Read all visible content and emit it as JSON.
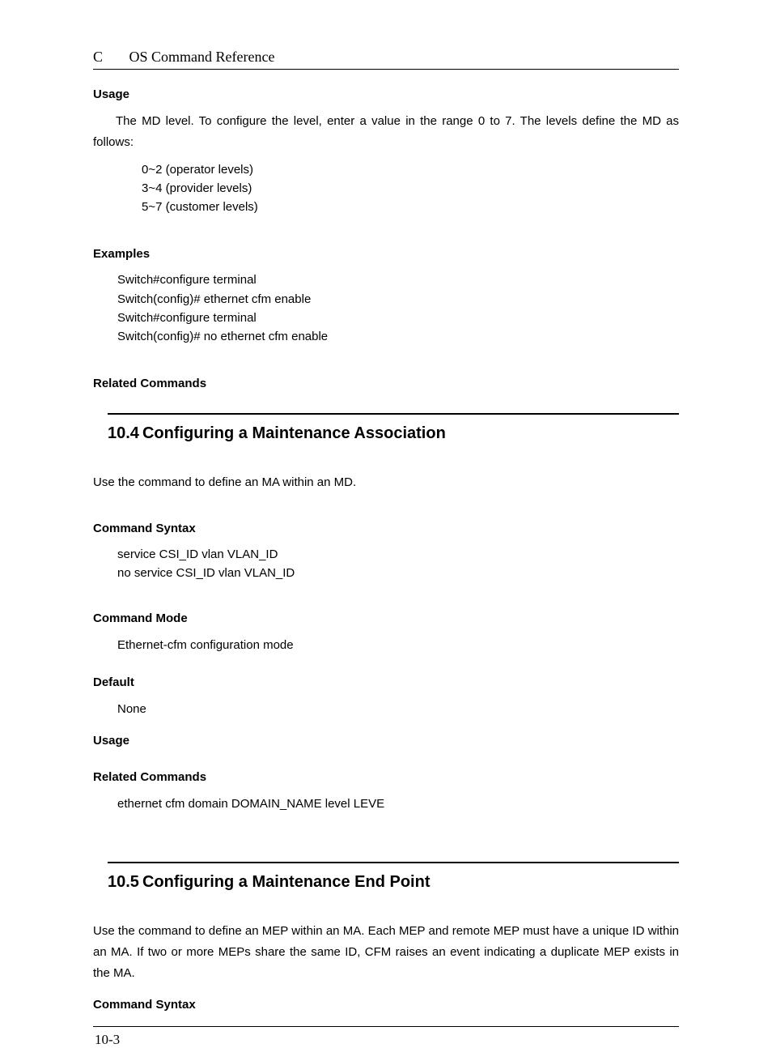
{
  "header": {
    "left": "C",
    "title": "OS Command Reference"
  },
  "sec_prev": {
    "usage_label": "Usage",
    "usage_text": "The MD level. To configure the level, enter a value in the range 0 to 7. The levels define the MD as follows:",
    "level_list": [
      "0~2 (operator levels)",
      "3~4 (provider levels)",
      "5~7 (customer levels)"
    ],
    "examples_label": "Examples",
    "examples": [
      "Switch#configure terminal",
      "Switch(config)# ethernet cfm enable",
      "Switch#configure terminal",
      "Switch(config)# no ethernet cfm enable"
    ],
    "related_label": "Related Commands"
  },
  "sec104": {
    "num": "10.4",
    "title": "Configuring a Maintenance Association",
    "intro": "Use the command to define an MA within an MD.",
    "syntax_label": "Command Syntax",
    "syntax": [
      "service CSI_ID vlan VLAN_ID",
      "no service CSI_ID vlan VLAN_ID"
    ],
    "mode_label": "Command Mode",
    "mode": "Ethernet-cfm configuration mode",
    "default_label": "Default",
    "default": "None",
    "usage_label": "Usage",
    "related_label": "Related Commands",
    "related": "ethernet cfm domain DOMAIN_NAME level LEVE"
  },
  "sec105": {
    "num": "10.5",
    "title": "Configuring a Maintenance End Point",
    "intro": "Use the command to define an MEP within an MA. Each MEP and remote MEP must have a unique ID within an MA. If two or more MEPs share the same ID, CFM raises an event indicating a duplicate MEP exists in the MA.",
    "syntax_label": "Command Syntax"
  },
  "footer": {
    "page": "10-3"
  }
}
